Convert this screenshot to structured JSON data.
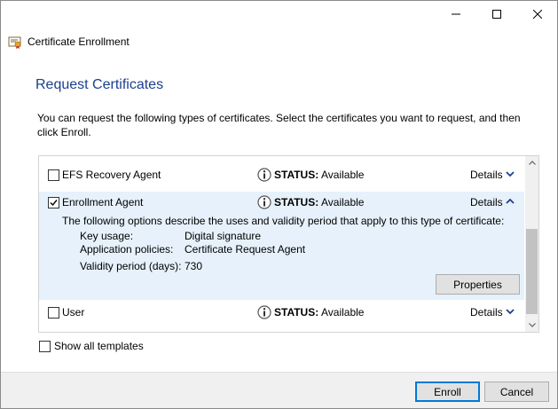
{
  "window": {
    "title": "Certificate Enrollment",
    "controls": [
      "minimize-icon",
      "maximize-icon",
      "close-icon"
    ]
  },
  "page": {
    "heading": "Request Certificates",
    "description": "You can request the following types of certificates. Select the certificates you want to request, and then click Enroll."
  },
  "certificates": [
    {
      "name": "EFS Recovery Agent",
      "checked": false,
      "status_label": "STATUS:",
      "status_value": "Available",
      "details_label": "Details",
      "expanded": false
    },
    {
      "name": "Enrollment Agent",
      "checked": true,
      "status_label": "STATUS:",
      "status_value": "Available",
      "details_label": "Details",
      "expanded": true,
      "expanded_description": "The following options describe the uses and validity period that apply to this type of certificate:",
      "key_usage_label": "Key usage:",
      "key_usage_value": "Digital signature",
      "app_policies_label": "Application policies:",
      "app_policies_value": "Certificate Request Agent",
      "validity_label": "Validity period (days):",
      "validity_value": "730",
      "properties_label": "Properties"
    },
    {
      "name": "User",
      "checked": false,
      "status_label": "STATUS:",
      "status_value": "Available",
      "details_label": "Details",
      "expanded": false
    }
  ],
  "show_all_templates": {
    "label": "Show all templates",
    "checked": false
  },
  "buttons": {
    "enroll": "Enroll",
    "cancel": "Cancel"
  },
  "colors": {
    "heading": "#1b3f8f",
    "expanded_bg": "#e6f1fb",
    "accent": "#0078d7"
  }
}
